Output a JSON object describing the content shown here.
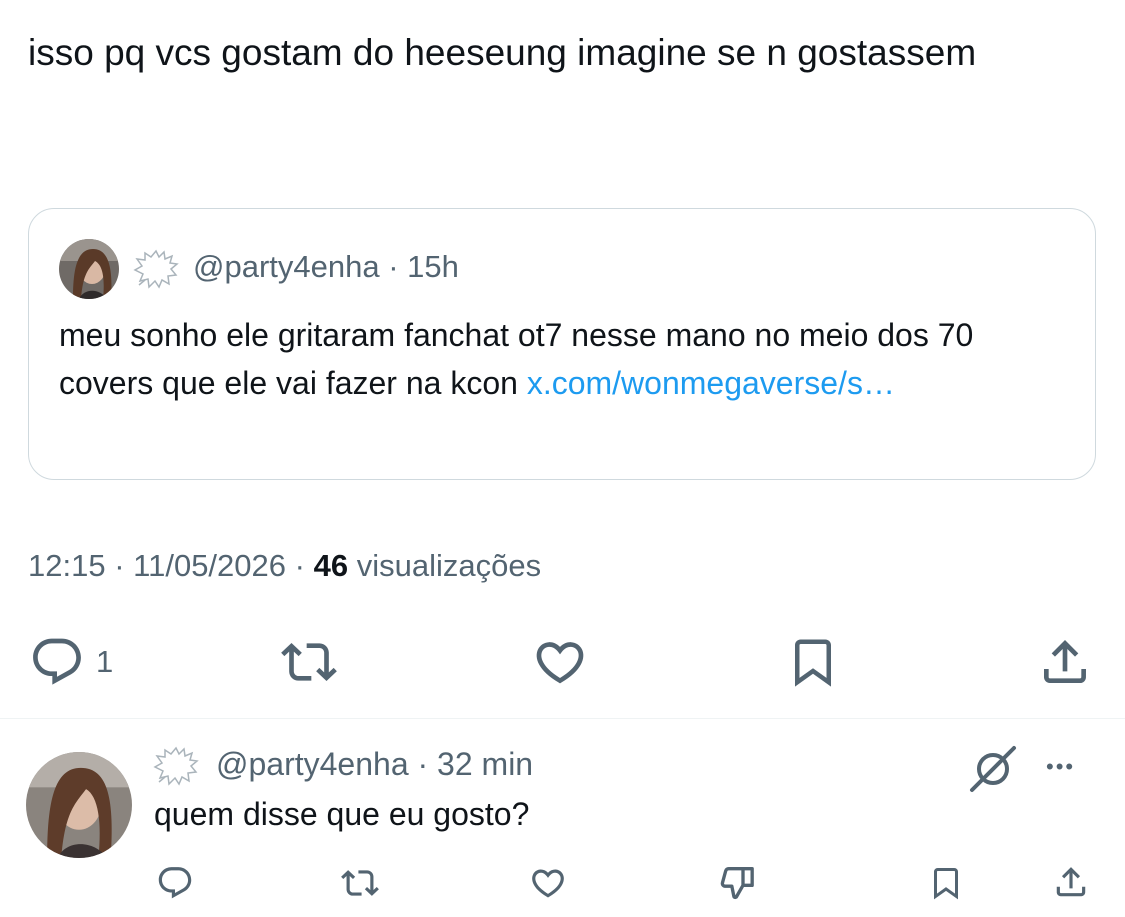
{
  "tweet": {
    "text": "isso pq vcs gostam do heeseung imagine se n gostassem",
    "time": "12:15",
    "date": "11/05/2026",
    "views_count": "46",
    "views_label": "visualizações",
    "separator": "·"
  },
  "quote": {
    "handle": "@party4enha",
    "age": "15h",
    "text": "meu sonho ele gritaram fanchat ot7 nesse mano no meio dos 70 covers que ele vai fazer na kcon ",
    "link": "x.com/wonmegaverse/s…"
  },
  "actions": {
    "reply_count": "1",
    "icons": [
      "reply-icon",
      "retweet-icon",
      "like-icon",
      "bookmark-icon",
      "share-icon"
    ]
  },
  "reply": {
    "handle": "@party4enha",
    "age": "32 min",
    "text": "quem disse que eu gosto?",
    "more_label": "•••",
    "icons": [
      "reply-icon",
      "retweet-icon",
      "like-icon",
      "dislike-icon",
      "bookmark-icon",
      "share-icon",
      "grok-icon",
      "more-icon"
    ]
  },
  "colors": {
    "text": "#0f1419",
    "secondary": "#536471",
    "link": "#1d9bf0",
    "border": "#cfd9de"
  }
}
